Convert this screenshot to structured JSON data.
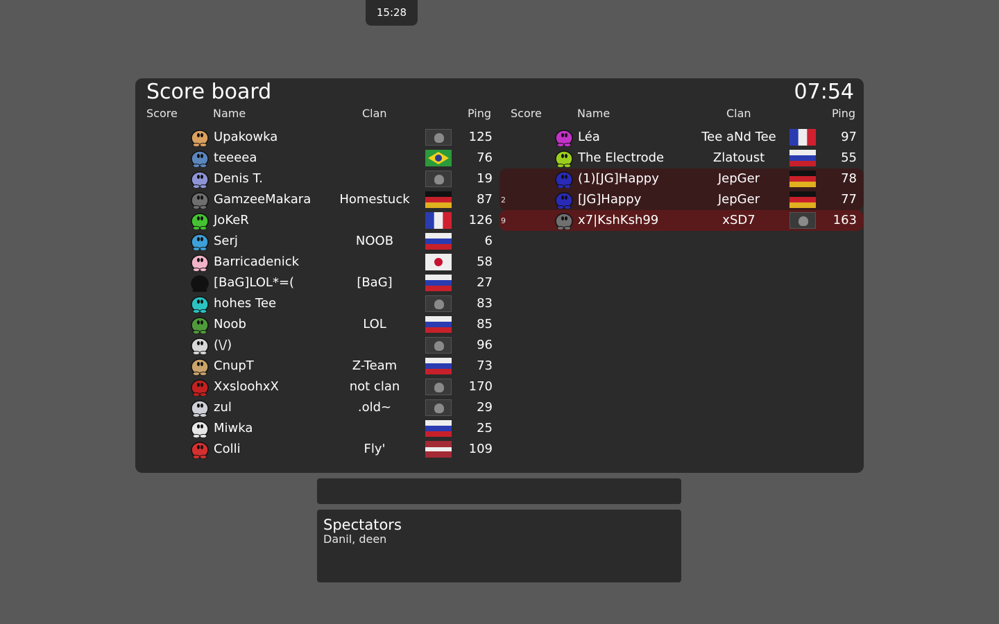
{
  "hud": {
    "round_timer": "15:28"
  },
  "scoreboard": {
    "title": "Score board",
    "clock": "07:54",
    "headers": {
      "score": "Score",
      "name": "Name",
      "clan": "Clan",
      "ping": "Ping"
    },
    "left_team": [
      {
        "rank": "",
        "name": "Upakowka",
        "clan": "",
        "flag": "unknown",
        "ping": "125",
        "tee": "#d9a05f"
      },
      {
        "rank": "",
        "name": "teeeea",
        "clan": "",
        "flag": "brazil",
        "ping": "76",
        "tee": "#5b86bd"
      },
      {
        "rank": "",
        "name": "Denis T.",
        "clan": "",
        "flag": "unknown",
        "ping": "19",
        "tee": "#8d93d4"
      },
      {
        "rank": "",
        "name": "GamzeeMakara",
        "clan": "Homestuck",
        "flag": "germany",
        "ping": "87",
        "tee": "#6e6e6e"
      },
      {
        "rank": "",
        "name": "JoKeR",
        "clan": "",
        "flag": "france",
        "ping": "126",
        "tee": "#44c231"
      },
      {
        "rank": "",
        "name": "Serj",
        "clan": "NOOB",
        "flag": "russia",
        "ping": "6",
        "tee": "#3ea0d8"
      },
      {
        "rank": "",
        "name": "Barricadenick",
        "clan": "",
        "flag": "japan",
        "ping": "58",
        "tee": "#f2b3c9"
      },
      {
        "rank": "",
        "name": "[BaG]LOL*=(",
        "clan": "[BaG]",
        "flag": "russia",
        "ping": "27",
        "tee": "#111111"
      },
      {
        "rank": "",
        "name": "hohes Tee",
        "clan": "",
        "flag": "unknown",
        "ping": "83",
        "tee": "#2bc2c2"
      },
      {
        "rank": "",
        "name": "Noob",
        "clan": "LOL",
        "flag": "russia",
        "ping": "85",
        "tee": "#4f9a3a"
      },
      {
        "rank": "",
        "name": "(\\/)",
        "clan": "",
        "flag": "unknown",
        "ping": "96",
        "tee": "#d8d8d8"
      },
      {
        "rank": "",
        "name": "CnupT",
        "clan": "Z-Team",
        "flag": "russia",
        "ping": "73",
        "tee": "#c9a36a"
      },
      {
        "rank": "",
        "name": "XxsloohxX",
        "clan": "not clan",
        "flag": "unknown",
        "ping": "170",
        "tee": "#c42020"
      },
      {
        "rank": "",
        "name": "zul",
        "clan": ".old~",
        "flag": "unknown",
        "ping": "29",
        "tee": "#cfcfd8"
      },
      {
        "rank": "",
        "name": "Miwka",
        "clan": "",
        "flag": "russia",
        "ping": "25",
        "tee": "#e6e6e6"
      },
      {
        "rank": "",
        "name": "Colli",
        "clan": "Fly'",
        "flag": "latvia",
        "ping": "109",
        "tee": "#d43030"
      }
    ],
    "right_team": [
      {
        "rank": "",
        "name": "Léa",
        "clan": "Tee aNd Tee",
        "flag": "france",
        "ping": "97",
        "tee": "#c232c6",
        "hl": ""
      },
      {
        "rank": "",
        "name": "The Electrode",
        "clan": "Zlatoust",
        "flag": "russia",
        "ping": "55",
        "tee": "#9acd1e",
        "hl": ""
      },
      {
        "rank": "",
        "name": "(1)[JG]Happy",
        "clan": "JepGer",
        "flag": "germany",
        "ping": "78",
        "tee": "#2a2ab8",
        "hl": "dark-first"
      },
      {
        "rank": "2",
        "name": "[JG]Happy",
        "clan": "JepGer",
        "flag": "germany",
        "ping": "77",
        "tee": "#2a2ab8",
        "hl": "dark-last"
      },
      {
        "rank": "9",
        "name": "x7|KshKsh99",
        "clan": "xSD7",
        "flag": "unknown",
        "ping": "163",
        "tee": "#707070",
        "hl": "red"
      }
    ]
  },
  "spectators": {
    "title": "Spectators",
    "names": "Danil, deen"
  }
}
